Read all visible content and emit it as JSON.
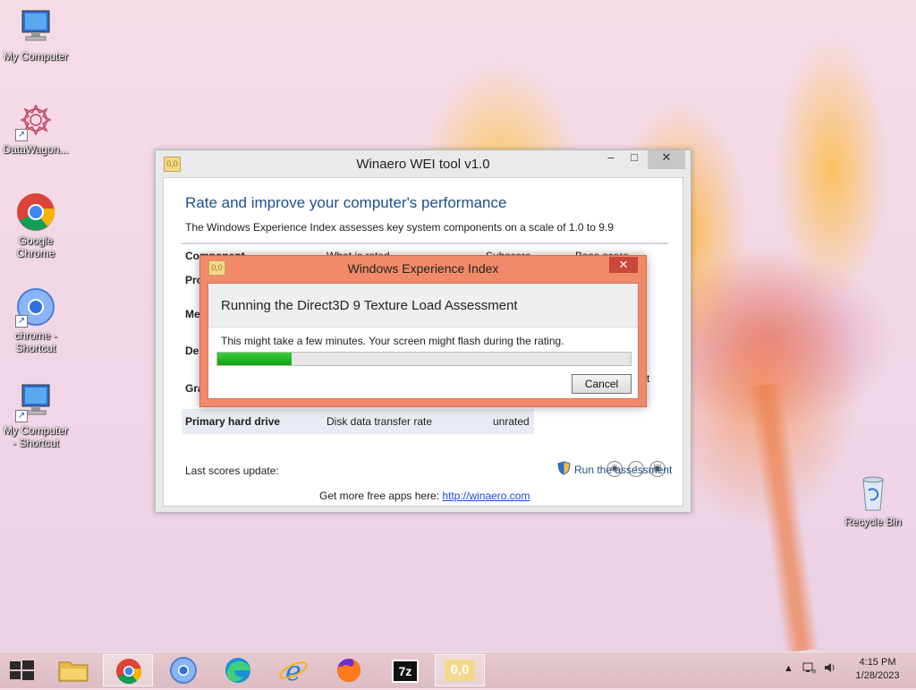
{
  "desktop": {
    "icons": [
      {
        "label_lines": [
          "My Computer"
        ]
      },
      {
        "label_lines": [
          "DataWagon..."
        ]
      },
      {
        "label_lines": [
          "Google",
          "Chrome"
        ]
      },
      {
        "label_lines": [
          "chrome -",
          "Shortcut"
        ]
      },
      {
        "label_lines": [
          "My Computer",
          "- Shortcut"
        ]
      },
      {
        "label_lines": [
          "Recycle Bin"
        ]
      }
    ]
  },
  "main_window": {
    "app_icon_text": "0,0",
    "title": "Winaero WEI tool v1.0",
    "controls": {
      "minimize": "–",
      "maximize": "□",
      "close": "✕"
    },
    "heading": "Rate and improve your computer's performance",
    "description": "The Windows Experience Index assesses key system components on a scale of 1.0 to 9.9",
    "columns": [
      "Component",
      "What is rated",
      "Subscore",
      "Base score"
    ],
    "rows_partial": [
      "Pro",
      "Me",
      "Des",
      "Gra"
    ],
    "trailing_fragment": "t",
    "last_row": {
      "component": "Primary hard drive",
      "what": "Disk data transfer rate",
      "score": "unrated"
    },
    "last_update_label": "Last scores update:",
    "run_link": "Run the assessment",
    "footer_text": "Get more free apps here:",
    "footer_link": "http://winaero.com"
  },
  "dialog": {
    "app_icon_text": "0,0",
    "title": "Windows Experience Index",
    "close": "✕",
    "heading": "Running the Direct3D 9 Texture Load Assessment",
    "message": "This might take a few minutes. Your screen might flash during the rating.",
    "progress_fraction": 0.18,
    "cancel_label": "Cancel"
  },
  "taskbar": {
    "apps": [
      "start",
      "file-explorer",
      "chrome",
      "chromium",
      "edge",
      "internet-explorer",
      "firefox",
      "7-zip",
      "winaero-wei"
    ],
    "sevenzip_label": "7z",
    "wei_label": "0,0",
    "time": "4:15 PM",
    "date": "1/28/2023"
  }
}
